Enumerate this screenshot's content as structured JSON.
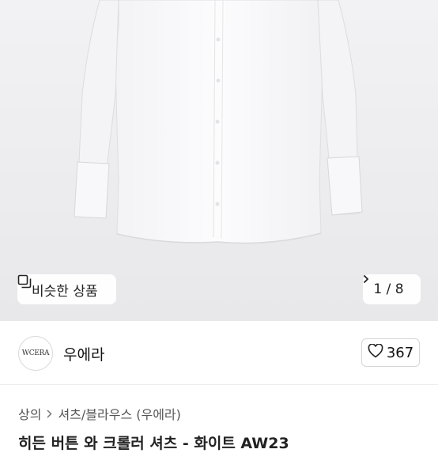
{
  "gallery": {
    "similar_label": "비슷한 상품",
    "current_page": "1",
    "total_pages": "8",
    "image_colors": {
      "background": "#ededef",
      "shirt": "#fbfbfc",
      "shirt_shadow": "#d9d9de"
    }
  },
  "seller": {
    "avatar_text": "WCERA",
    "name": "우에라",
    "like_count": "367"
  },
  "breadcrumb": {
    "items": [
      "상의",
      "셔츠/블라우스 (우에라)"
    ]
  },
  "product": {
    "title_partial": "히든 버튼 와 크롤러 셔츠 - 화이트 AW23"
  }
}
